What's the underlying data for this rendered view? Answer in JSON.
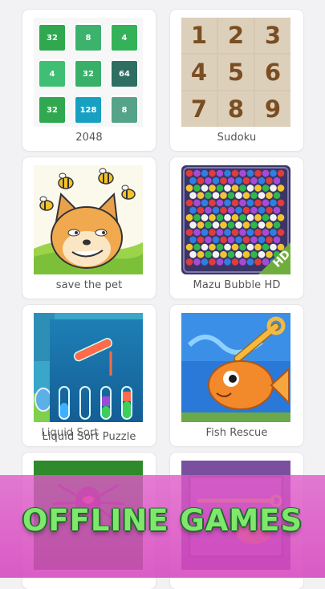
{
  "games": [
    {
      "label": "2048"
    },
    {
      "label": "Sudoku"
    },
    {
      "label": "save the pet"
    },
    {
      "label": "Mazu Bubble HD"
    },
    {
      "label": "Liquid Sort Puzzle",
      "overlay_label": "Liquid Sort"
    },
    {
      "label": "Fish Rescue"
    }
  ],
  "tiles_2048": [
    "32",
    "8",
    "4",
    "4",
    "32",
    "64",
    "32",
    "128",
    "8"
  ],
  "tile_colors": [
    "#2fa84f",
    "#3cb26c",
    "#34b25a",
    "#3fbf74",
    "#38b06a",
    "#2f6e63",
    "#3aaa5a",
    "#16a0c2",
    "#55a389"
  ],
  "sudoku_digits": [
    "1",
    "2",
    "3",
    "4",
    "5",
    "6",
    "7",
    "8",
    "9"
  ],
  "bubble_badge": "HD",
  "banner": {
    "text": "OFFLINE GAMES"
  }
}
